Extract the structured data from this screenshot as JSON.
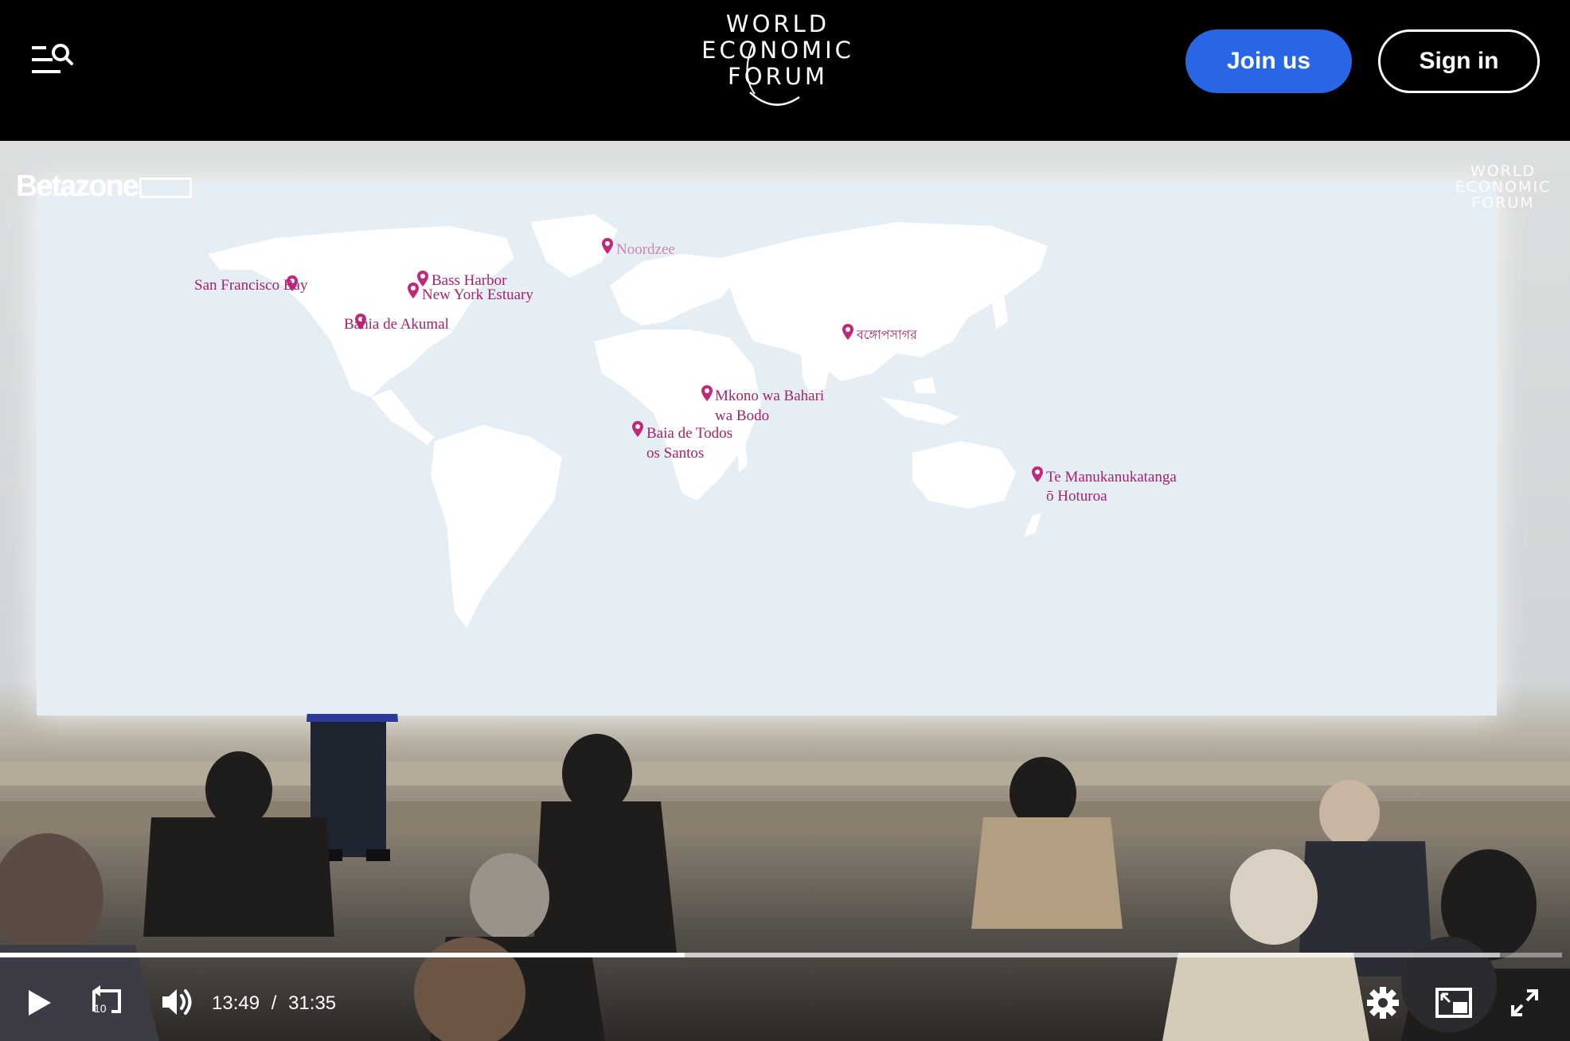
{
  "header": {
    "logo_lines": [
      "WORLD",
      "ECONOMIC",
      "FORUM"
    ],
    "join_label": "Join us",
    "signin_label": "Sign in"
  },
  "video": {
    "watermark_left": "Betazone",
    "watermark_right_lines": [
      "WORLD",
      "ECONOMIC",
      "FORUM"
    ],
    "map_labels": [
      {
        "text": "San Francisco Bay"
      },
      {
        "text": "Bass Harbor"
      },
      {
        "text": "New York Estuary"
      },
      {
        "text": "Bahia de Akumal"
      },
      {
        "text": "Noordzee"
      },
      {
        "text": "বঙ্গোপসাগর"
      },
      {
        "text": "Mkono wa Bahari"
      },
      {
        "text": "wa Bodo"
      },
      {
        "text": "Baia de Todos"
      },
      {
        "text": "os Santos"
      },
      {
        "text": "Te Manukanukatanga"
      },
      {
        "text": "ō Hoturoa"
      }
    ]
  },
  "player": {
    "current_time": "13:49",
    "separator": "/",
    "duration": "31:35",
    "progress_fraction": 0.4385,
    "buffer_fraction": 0.96,
    "rewind_seconds": "10",
    "icons": [
      "play-icon",
      "rewind-10-icon",
      "volume-icon",
      "settings-icon",
      "miniplayer-icon",
      "fullscreen-icon"
    ]
  }
}
